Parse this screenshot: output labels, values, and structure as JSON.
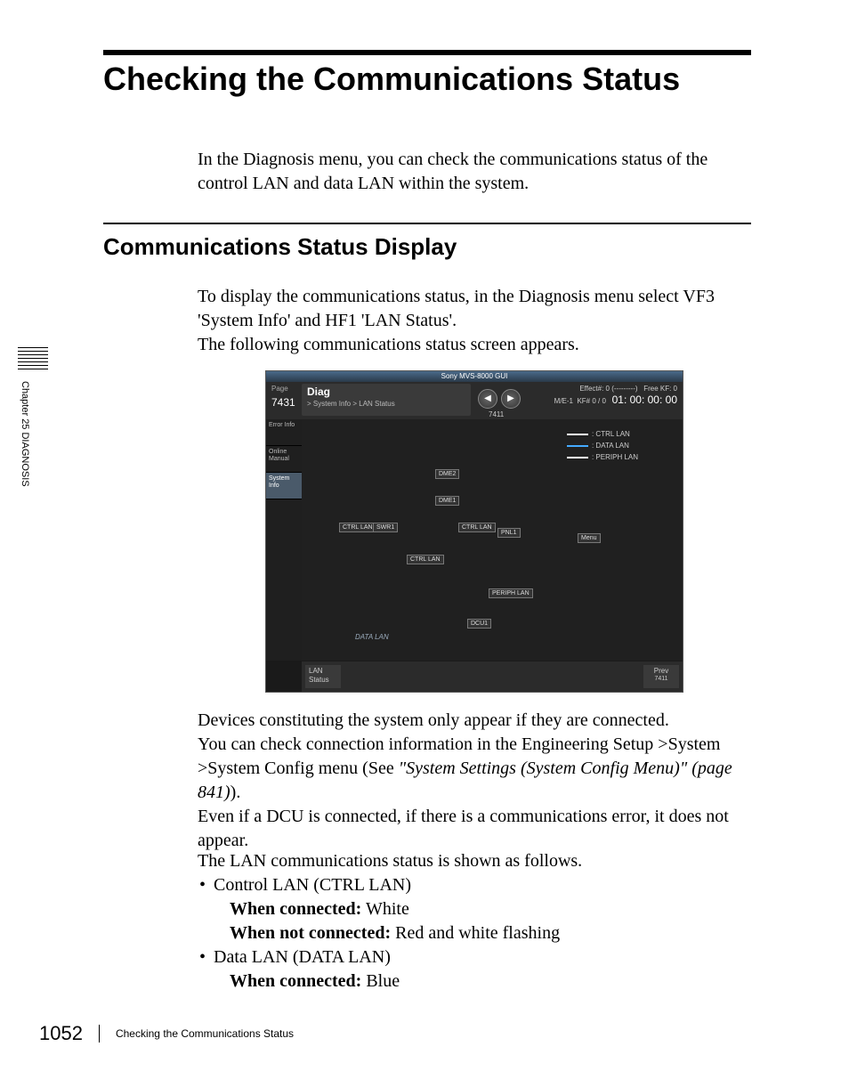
{
  "heading1": "Checking the Communications Status",
  "intro": "In the Diagnosis menu, you can check the communications status of the control LAN and data LAN within the system.",
  "heading2": "Communications Status Display",
  "para1_a": "To display the communications status, in the Diagnosis menu select VF3 'System Info' and HF1 'LAN Status'.",
  "para1_b": "The following communications status screen appears.",
  "screenshot": {
    "titlebar": "Sony MVS-8000 GUI",
    "page_label": "Page",
    "page_num": "7431",
    "diag_title": "Diag",
    "diag_path": "> System Info > LAN Status",
    "arrow_num": "7411",
    "effect": "Effect#: 0 (---------)",
    "me": "M/E-1",
    "kf": "KF# 0 / 0",
    "free_kf": "Free KF: 0",
    "timecode": "01: 00: 00: 00",
    "side": {
      "error": "Error\nInfo",
      "online": "Online\nManual",
      "system": "System\nInfo"
    },
    "legend": {
      "ctrl": ": CTRL LAN",
      "data": ": DATA LAN",
      "periph": ": PERIPH LAN"
    },
    "labels": {
      "dme2": "DME2",
      "dme1": "DME1",
      "ctrl_lan": "CTRL LAN",
      "swr1": "SWR1",
      "pnl1": "PNL1",
      "periph_lan": "PERIPH LAN",
      "dcu1": "DCU1",
      "data_lan": "DATA LAN",
      "menu": "Menu"
    },
    "footer": {
      "lan_status": "LAN\nStatus",
      "prev": "Prev",
      "prev_num": "7411"
    }
  },
  "para2_a": "Devices constituting the system only appear if they are connected.",
  "para2_b": "You can check connection information in the Engineering Setup >System >System Config menu (See ",
  "para2_link": "\"System Settings (System Config Menu)\" (page 841)",
  "para2_c": ").",
  "para2_d": "Even if a DCU is connected, if there is a communications error, it does not appear.",
  "para3_intro": "The LAN communications status is shown as follows.",
  "bullets": {
    "b1": "Control LAN (CTRL LAN)",
    "b1a_label": "When connected:",
    "b1a_val": " White",
    "b1b_label": "When not connected:",
    "b1b_val": " Red and white flashing",
    "b2": "Data LAN (DATA LAN)",
    "b2a_label": "When connected:",
    "b2a_val": " Blue"
  },
  "side_rail": "Chapter 25   DIAGNOSIS",
  "footer": {
    "page": "1052",
    "title": "Checking the Communications Status"
  }
}
